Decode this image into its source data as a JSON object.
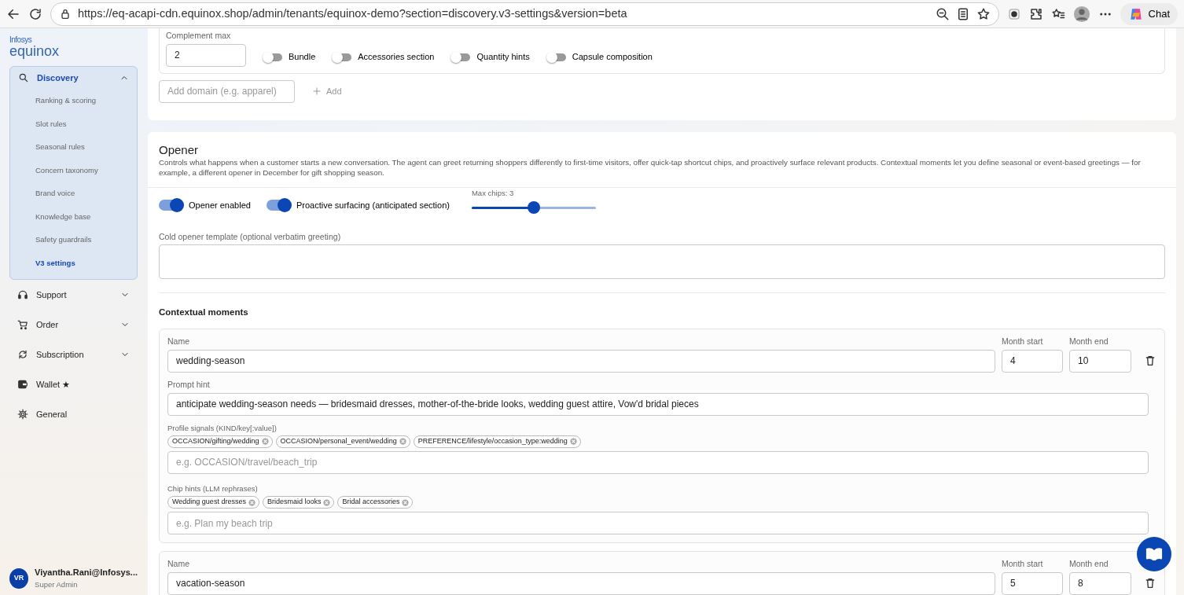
{
  "browser": {
    "url": "https://eq-acapi-cdn.equinox.shop/admin/tenants/equinox-demo?section=discovery.v3-settings&version=beta",
    "chat_label": "Chat"
  },
  "sidebar": {
    "logo_top": "Infosys",
    "logo_bottom": "equinox",
    "items": [
      {
        "label": "Discovery",
        "kind": "group",
        "expanded": true,
        "selected": true,
        "children": [
          {
            "label": "Ranking & scoring",
            "selected": false
          },
          {
            "label": "Slot rules",
            "selected": false
          },
          {
            "label": "Seasonal rules",
            "selected": false
          },
          {
            "label": "Concern taxonomy",
            "selected": false
          },
          {
            "label": "Brand voice",
            "selected": false
          },
          {
            "label": "Knowledge base",
            "selected": false
          },
          {
            "label": "Safety guardrails",
            "selected": false
          },
          {
            "label": "V3 settings",
            "selected": true
          }
        ]
      },
      {
        "label": "Support",
        "kind": "group",
        "expanded": false,
        "selected": false
      },
      {
        "label": "Order",
        "kind": "group",
        "expanded": false,
        "selected": false
      },
      {
        "label": "Subscription",
        "kind": "group",
        "expanded": false,
        "selected": false
      },
      {
        "label": "Wallet ★",
        "kind": "link",
        "selected": false
      },
      {
        "label": "General",
        "kind": "link",
        "selected": false
      }
    ],
    "user": {
      "initials": "VR",
      "name": "Viyantha.Rani@Infosys...",
      "role": "Super Admin"
    }
  },
  "domain_card": {
    "complement_max": {
      "label": "Complement max",
      "value": "2"
    },
    "toggles": [
      {
        "label": "Bundle",
        "on": false
      },
      {
        "label": "Accessories section",
        "on": false
      },
      {
        "label": "Quantity hints",
        "on": false
      },
      {
        "label": "Capsule composition",
        "on": false
      }
    ],
    "add_domain": {
      "placeholder": "Add domain (e.g. apparel)",
      "button": "Add"
    }
  },
  "opener": {
    "title": "Opener",
    "description": "Controls what happens when a customer starts a new conversation. The agent can greet returning shoppers differently to first-time visitors, offer quick-tap shortcut chips, and proactively surface relevant products. Contextual moments let you define seasonal or event-based greetings — for example, a different opener in December for gift shopping season.",
    "toggles": [
      {
        "label": "Opener enabled",
        "on": true
      },
      {
        "label": "Proactive surfacing (anticipated section)",
        "on": true
      }
    ],
    "slider": {
      "label": "Max chips: 3",
      "level": 0.5
    },
    "template": {
      "label": "Cold opener template (optional verbatim greeting)"
    },
    "moments_title": "Contextual moments",
    "moments": [
      {
        "name_label": "Name",
        "name": "wedding-season",
        "month_start_label": "Month start",
        "month_start": "4",
        "month_end_label": "Month end",
        "month_end": "10",
        "prompt_hint": {
          "label": "Prompt hint",
          "value": "anticipate wedding-season needs — bridesmaid dresses, mother-of-the-bride looks, wedding guest attire, Vow'd bridal pieces"
        },
        "signals_label": "Profile signals (KIND/key[:value])",
        "signals": [
          "OCCASION/gifting/wedding",
          "OCCASION/personal_event/wedding",
          "PREFERENCE/lifestyle/occasion_type:wedding"
        ],
        "signals_placeholder": "e.g. OCCASION/travel/beach_trip",
        "chips_label": "Chip hints (LLM rephrases)",
        "chips": [
          "Wedding guest dresses",
          "Bridesmaid looks",
          "Bridal accessories"
        ],
        "chips_placeholder": "e.g. Plan my beach trip"
      },
      {
        "name_label": "Name",
        "name": "vacation-season",
        "month_start_label": "Month start",
        "month_start": "5",
        "month_end_label": "Month end",
        "month_end": "8"
      }
    ]
  }
}
